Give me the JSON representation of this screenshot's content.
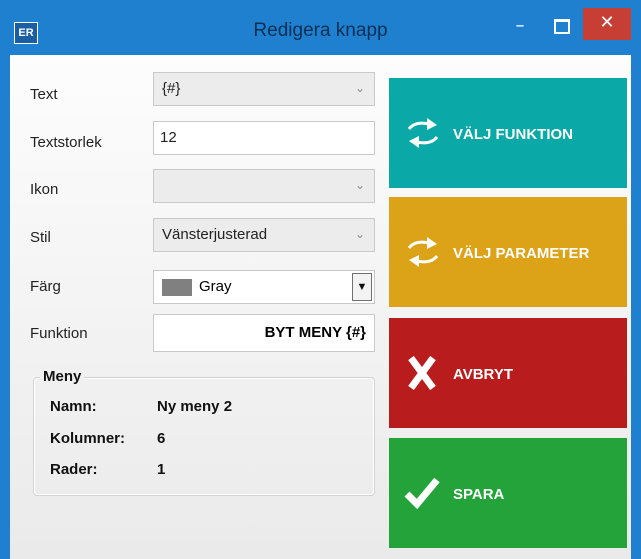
{
  "window": {
    "title": "Redigera knapp",
    "app_icon": "ER",
    "minimize": "–",
    "close": "✕"
  },
  "form": {
    "text_label": "Text",
    "text_value": "{#}",
    "size_label": "Textstorlek",
    "size_value": "12",
    "icon_label": "Ikon",
    "icon_value": "",
    "style_label": "Stil",
    "style_value": "Vänsterjusterad",
    "color_label": "Färg",
    "color_value": "Gray",
    "color_swatch": "#808080",
    "function_label": "Funktion",
    "function_value": "BYT MENY {#}"
  },
  "menu_group": {
    "title": "Meny",
    "rows": [
      {
        "label": "Namn:",
        "value": "Ny meny 2"
      },
      {
        "label": "Kolumner:",
        "value": "6"
      },
      {
        "label": "Rader:",
        "value": "1"
      }
    ]
  },
  "actions": {
    "choose_function": "VÄLJ FUNKTION",
    "choose_parameter": "VÄLJ PARAMETER",
    "cancel": "AVBRYT",
    "save": "SPARA"
  },
  "colors": {
    "teal": "#0aa8a6",
    "gold": "#dca218",
    "red": "#b91c1c",
    "green": "#23a33a",
    "title_bar": "#1f80cf"
  },
  "icons": [
    "swap-arrows-icon",
    "close-x-icon",
    "checkmark-icon",
    "chevron-down-icon",
    "minimize-icon",
    "maximize-icon",
    "close-icon"
  ]
}
